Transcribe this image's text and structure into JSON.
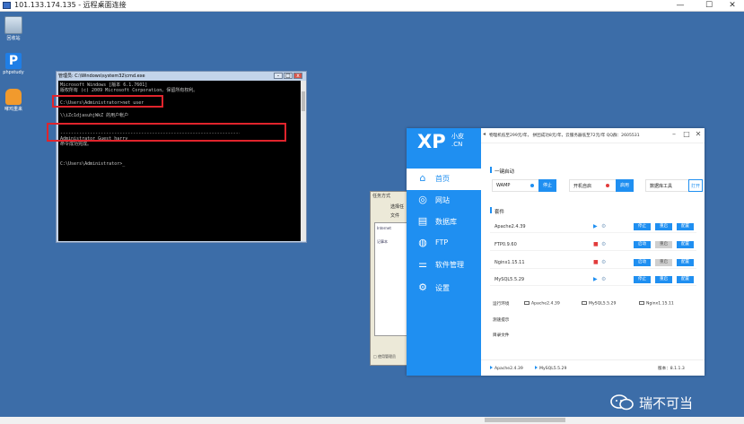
{
  "rdp": {
    "title": "101.133.174.135 - 远程桌面连接",
    "min": "—",
    "max": "☐",
    "close": "✕"
  },
  "desktop_icons": [
    {
      "label": "回收站",
      "icon": "recycle-bin-icon"
    },
    {
      "label": "phpstudy",
      "icon": "phpstudy-icon"
    },
    {
      "label": "哮鸡重来",
      "icon": "fox-icon"
    }
  ],
  "cmd": {
    "title": "管理员: C:\\Windows\\system32\\cmd.exe",
    "lines": [
      "Microsoft Windows [版本 6.1.7601]",
      "版权所有 (c) 2009 Microsoft Corporation。保留所有权利。",
      "",
      "C:\\Users\\Administrator>net user",
      "",
      "\\\\iZc1djasuhjWkZ 的用户帐户",
      "",
      "-------------------------------------------------------------------------------",
      "Administrator            Guest                    harry",
      "命令成功完成。",
      "",
      "C:\\Users\\Administrator>_"
    ]
  },
  "taskwin": {
    "title": "任务方式",
    "line1": "选择任",
    "line2": "文件",
    "item1": "Internet",
    "item2": "记事本",
    "bottom": "□ 使用管理员"
  },
  "xp": {
    "logo": "XP",
    "logo_small": "小皮",
    "logo_cn": ".CN",
    "announcement": "物理机低至299元/年，  拼团成功8元/年，云服务器低至72元/年    QQ群：2605531",
    "nav": [
      {
        "label": "首页",
        "icon": "home-icon"
      },
      {
        "label": "网站",
        "icon": "globe-icon"
      },
      {
        "label": "数据库",
        "icon": "database-icon"
      },
      {
        "label": "FTP",
        "icon": "ftp-icon"
      },
      {
        "label": "软件管理",
        "icon": "software-icon"
      },
      {
        "label": "设置",
        "icon": "settings-icon"
      }
    ],
    "quick": {
      "title": "一键启动",
      "wamp_label": "WAMP",
      "wamp_btn": "停止",
      "boot_label": "开机自启",
      "boot_btn": "启用",
      "db_label": "数据库工具",
      "db_btn": "打开"
    },
    "suite": {
      "title": "套件",
      "rows": [
        {
          "name": "Apache2.4.39",
          "running": true,
          "btn1": "停止",
          "btn2": "重启",
          "btn3": "配置"
        },
        {
          "name": "FTP0.9.60",
          "running": false,
          "btn1": "启动",
          "btn2": "重启",
          "btn3": "配置"
        },
        {
          "name": "Nginx1.15.11",
          "running": false,
          "btn1": "启动",
          "btn2": "重启",
          "btn3": "配置"
        },
        {
          "name": "MySQL5.5.29",
          "running": true,
          "btn1": "停止",
          "btn2": "重启",
          "btn3": "配置"
        }
      ]
    },
    "dirs": {
      "label": "运行环境",
      "items": [
        "Apache2.4.39",
        "MySQL5.5.29",
        "Nginx1.15.11"
      ]
    },
    "links": [
      "测速提示",
      "目录文件"
    ],
    "footer": {
      "items": [
        "Apache2.4.39",
        "MySQL5.5.29"
      ],
      "version": "版本：8.1.1.3"
    }
  },
  "watermark": {
    "text": "瑞不可当"
  },
  "colors": {
    "desktop": "#3c6da8",
    "xp_blue": "#1f8ff1",
    "highlight_red": "#e0242c"
  }
}
